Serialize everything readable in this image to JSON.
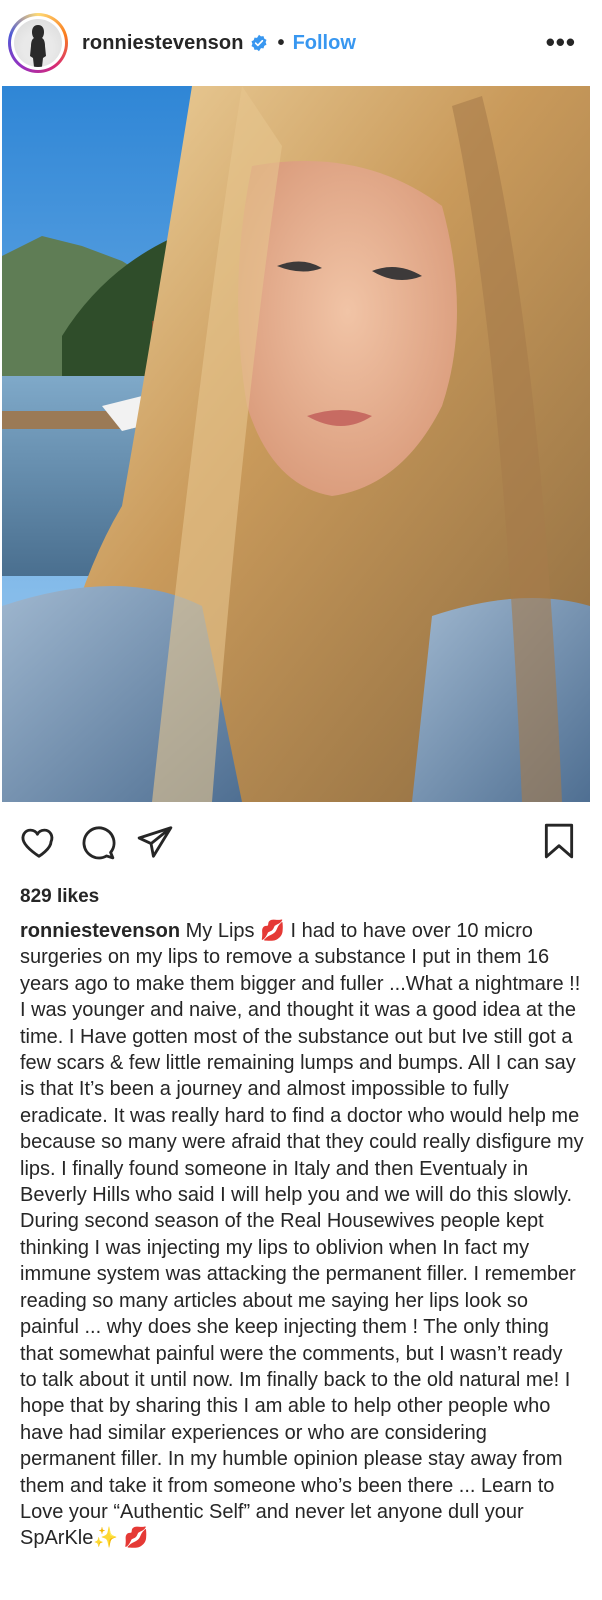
{
  "header": {
    "username": "ronniestevenson",
    "separator": "•",
    "follow_label": "Follow",
    "more_label": "•••"
  },
  "actions": {
    "like_icon": "heart-icon",
    "comment_icon": "comment-icon",
    "share_icon": "send-icon",
    "save_icon": "bookmark-icon"
  },
  "likes": "829 likes",
  "caption": {
    "username": "ronniestevenson",
    "text": " My Lips 💋 I had to have over 10 micro surgeries on my lips to remove a substance I put in them 16 years ago to make them bigger and fuller ...What a nightmare !! I was younger and naive, and thought it was a good idea at the time. I Have gotten most of the substance out but Ive still got a few scars & few little remaining lumps and bumps. All I can say is that It’s been a journey and almost impossible to fully eradicate. It was really hard to find a doctor who would help me because so many were afraid that they could really disfigure my lips. I finally found someone in Italy and then Eventualy in Beverly Hills who said I will help you and we will do this slowly. During second season of the Real Housewives people kept thinking I was injecting my lips to oblivion when In fact my immune system was attacking the permanent filler. I remember reading so many articles about me saying her lips look so painful ... why does she keep injecting them ! The only thing that somewhat painful were the comments, but I wasn’t ready to talk about it until now. Im finally back to the old natural me! I hope that by sharing this I am able to help other people who have had similar experiences or who are considering permanent filler. In my humble opinion please stay away from them and take it from someone who’s been there ... Learn to Love your “Authentic Self” and never let anyone dull your SpArKle✨ 💋"
  },
  "colors": {
    "follow": "#3897f0",
    "text": "#262626",
    "verified": "#3897f0"
  }
}
